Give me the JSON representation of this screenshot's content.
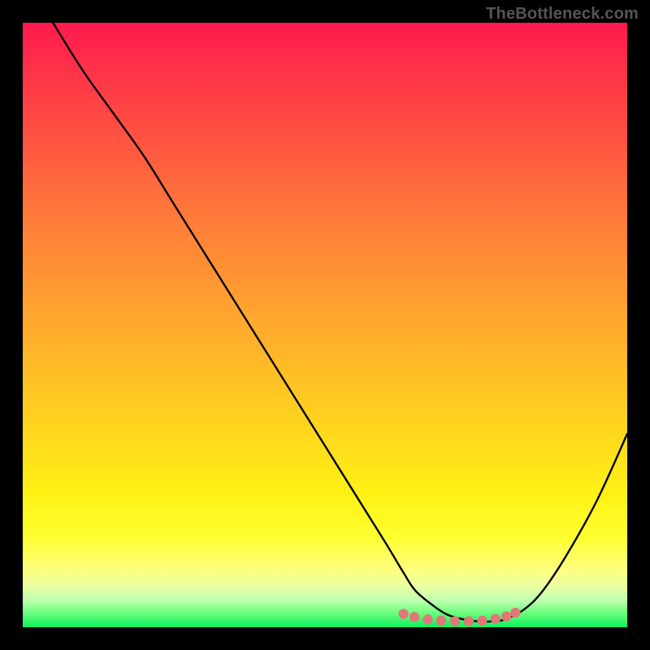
{
  "watermark": "TheBottleneck.com",
  "chart_data": {
    "type": "line",
    "title": "",
    "xlabel": "",
    "ylabel": "",
    "xlim": [
      0,
      100
    ],
    "ylim": [
      0,
      100
    ],
    "series": [
      {
        "name": "bottleneck-curve",
        "x": [
          5,
          10,
          15,
          20,
          25,
          30,
          35,
          40,
          45,
          50,
          55,
          60,
          63,
          65,
          68,
          70,
          72,
          75,
          78,
          80,
          83,
          86,
          90,
          95,
          100
        ],
        "y": [
          100,
          92,
          85,
          78,
          70,
          62,
          54,
          46,
          38,
          30,
          22,
          14,
          9,
          6,
          3.5,
          2.2,
          1.5,
          1.0,
          1.0,
          1.4,
          3,
          6,
          12,
          21,
          32
        ]
      }
    ],
    "markers": {
      "name": "annotation-dots",
      "points": [
        {
          "x": 63.0,
          "y": 2.2
        },
        {
          "x": 64.8,
          "y": 1.7
        },
        {
          "x": 67.0,
          "y": 1.3
        },
        {
          "x": 69.2,
          "y": 1.1
        },
        {
          "x": 71.5,
          "y": 1.0
        },
        {
          "x": 73.8,
          "y": 1.0
        },
        {
          "x": 76.0,
          "y": 1.1
        },
        {
          "x": 78.2,
          "y": 1.4
        },
        {
          "x": 80.0,
          "y": 1.8
        },
        {
          "x": 81.5,
          "y": 2.4
        }
      ]
    },
    "colors": {
      "curve": "#000000",
      "markers": "#e07878",
      "gradient_top": "#ff1a4d",
      "gradient_bottom": "#10f060",
      "background": "#000000"
    }
  }
}
